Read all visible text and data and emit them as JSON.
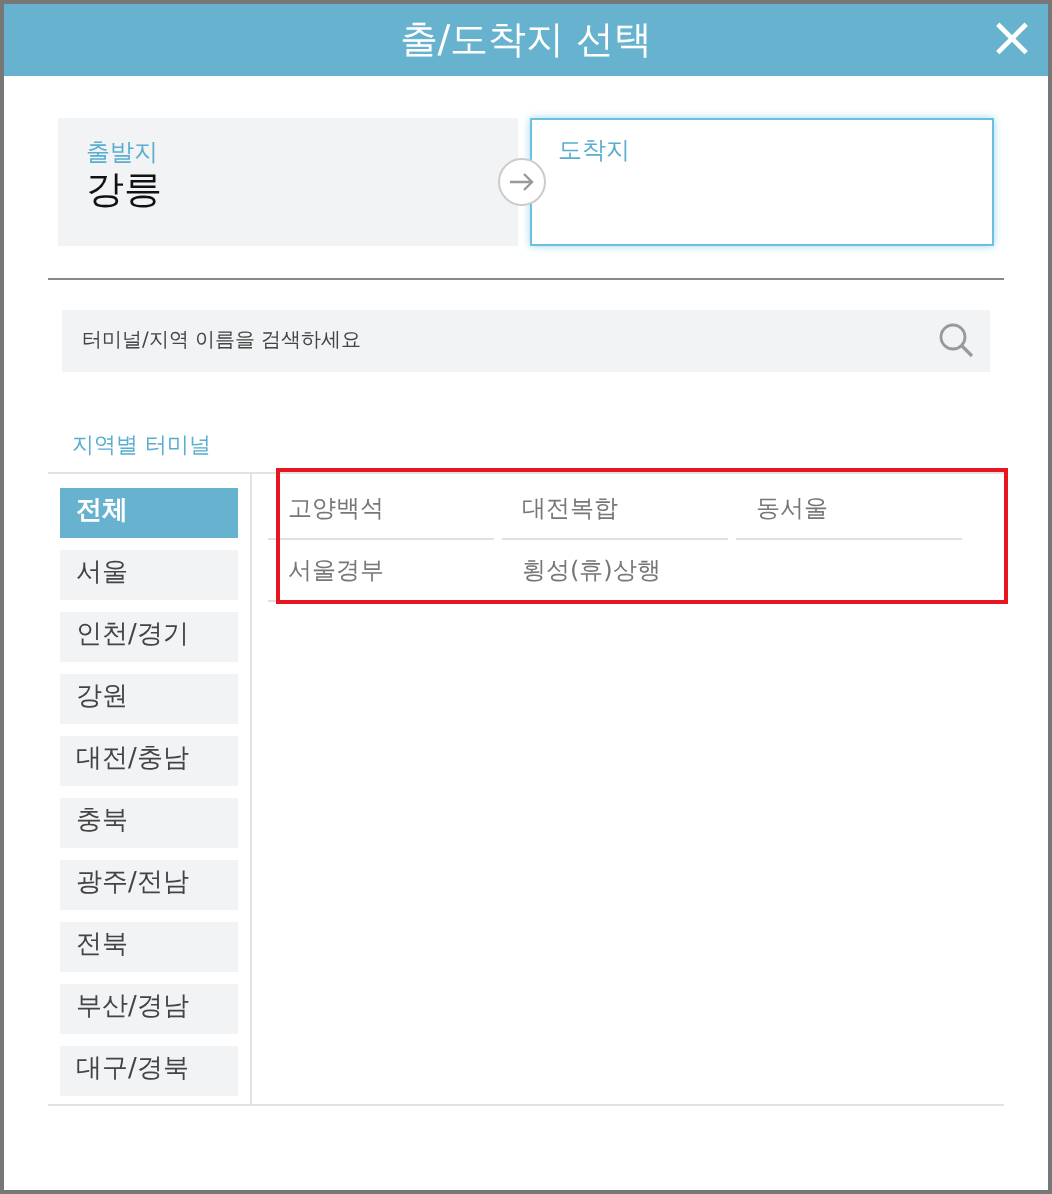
{
  "window": {
    "title": "출/도착지 선택",
    "close": "×"
  },
  "departure": {
    "label": "출발지",
    "value": "강릉"
  },
  "arrival": {
    "label": "도착지",
    "focused": true
  },
  "search": {
    "placeholder": "터미널/지역 이름을 검색하세요"
  },
  "section_title": "지역별 터미널",
  "regions": [
    {
      "label": "전체",
      "selected": true
    },
    {
      "label": "서울",
      "selected": false
    },
    {
      "label": "인천/경기",
      "selected": false
    },
    {
      "label": "강원",
      "selected": false
    },
    {
      "label": "대전/충남",
      "selected": false
    },
    {
      "label": "충북",
      "selected": false
    },
    {
      "label": "광주/전남",
      "selected": false
    },
    {
      "label": "전북",
      "selected": false
    },
    {
      "label": "부산/경남",
      "selected": false
    },
    {
      "label": "대구/경북",
      "selected": false
    }
  ],
  "terminals": [
    "고양백석",
    "대전복합",
    "동서울",
    "서울경부",
    "횡성(휴)상행"
  ]
}
